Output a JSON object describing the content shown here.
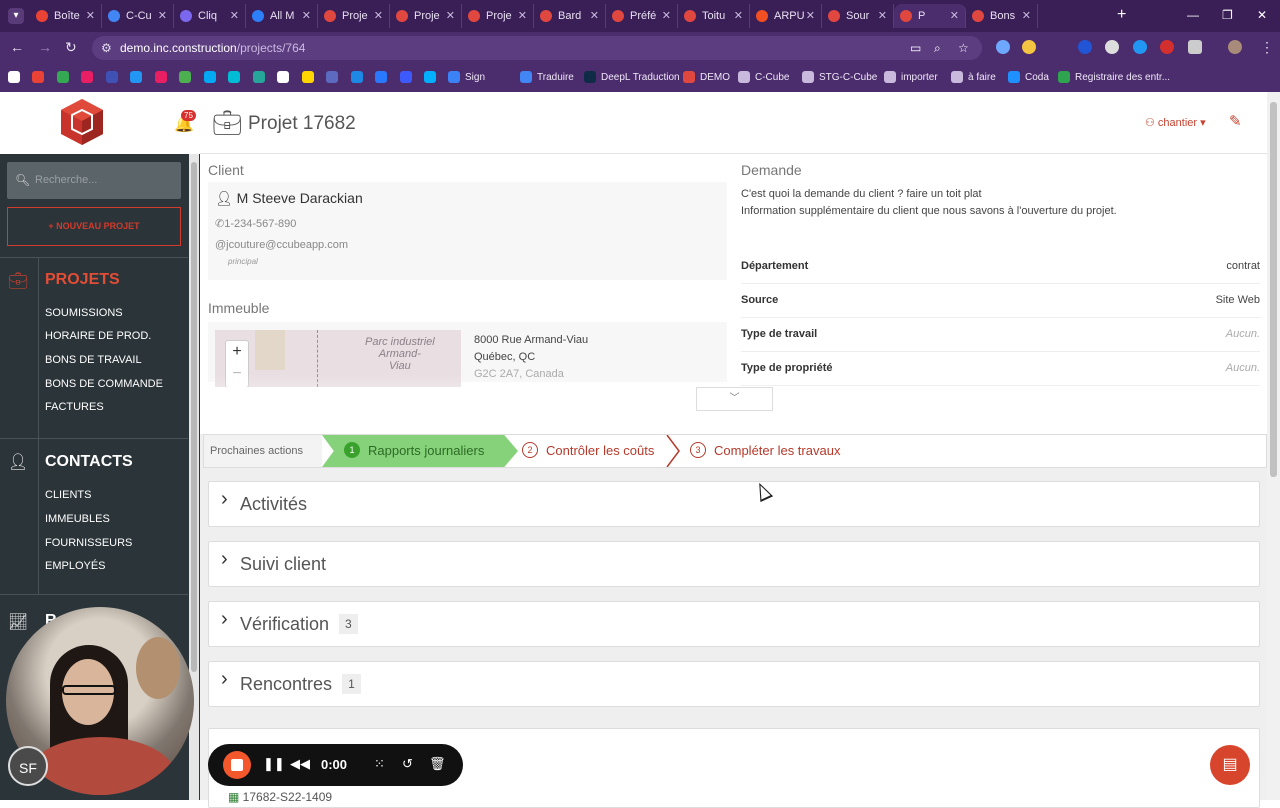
{
  "browser": {
    "tabs": [
      {
        "label": "Boîte",
        "color": "#ea4335"
      },
      {
        "label": "C-Cu",
        "color": "#4285f4"
      },
      {
        "label": "Cliq",
        "color": "#7b68ee"
      },
      {
        "label": "All M",
        "color": "#2d7ff9"
      },
      {
        "label": "Proje",
        "color": "#e0473f"
      },
      {
        "label": "Proje",
        "color": "#e0473f"
      },
      {
        "label": "Proje",
        "color": "#e0473f"
      },
      {
        "label": "Bard",
        "color": "#e0473f"
      },
      {
        "label": "Préfé",
        "color": "#e0473f"
      },
      {
        "label": "Toitu",
        "color": "#e0473f"
      },
      {
        "label": "ARPU",
        "color": "#f25022"
      },
      {
        "label": "Sour",
        "color": "#e0473f"
      },
      {
        "label": "P",
        "color": "#e0473f",
        "active": true
      },
      {
        "label": "Bons",
        "color": "#e0473f"
      }
    ],
    "url_host": "demo.inc.construction",
    "url_path": "/projects/764",
    "bookmarks": [
      {
        "label": "Sign",
        "color": "#3b82f6"
      },
      {
        "label": "Traduire",
        "color": "#4285f4"
      },
      {
        "label": "DeepL Traduction",
        "color": "#0f2b46"
      },
      {
        "label": "DEMO",
        "color": "#e0473f"
      },
      {
        "label": "C-Cube",
        "color": "#c9b9dd"
      },
      {
        "label": "STG-C-Cube",
        "color": "#c9b9dd"
      },
      {
        "label": "importer",
        "color": "#c9b9dd"
      },
      {
        "label": "à faire",
        "color": "#c9b9dd"
      },
      {
        "label": "Coda",
        "color": "#1e90ff"
      },
      {
        "label": "Registraire des entr...",
        "color": "#2ea44f"
      }
    ]
  },
  "sidebar": {
    "notification_count": "75",
    "search_placeholder": "Recherche...",
    "new_project_label": "+ NOUVEAU PROJET",
    "projects": {
      "title": "PROJETS",
      "items": [
        "SOUMISSIONS",
        "HORAIRE DE PROD.",
        "BONS DE TRAVAIL",
        "BONS DE COMMANDE",
        "FACTURES"
      ]
    },
    "contacts": {
      "title": "CONTACTS",
      "items": [
        "CLIENTS",
        "IMMEUBLES",
        "FOURNISSEURS",
        "EMPLOYÉS"
      ]
    },
    "reports_title_partial": "R"
  },
  "header": {
    "title": "Projet 17682",
    "view_select": "chantier"
  },
  "client": {
    "section_label": "Client",
    "name": "M Steeve Darackian",
    "phone": "1-234-567-890",
    "email": "jcouture@ccubeapp.com",
    "email_tag": "principal"
  },
  "building": {
    "section_label": "Immeuble",
    "map_label_1": "Parc industriel",
    "map_label_2": "Armand-",
    "map_label_3": "Viau",
    "address_line1": "8000 Rue Armand-Viau",
    "address_line2": "Québec, QC",
    "address_line3": "G2C 2A7, Canada"
  },
  "request": {
    "section_label": "Demande",
    "line1": "C'est quoi la demande du client ? faire un toit plat",
    "line2": "Information supplémentaire du client que nous savons à l'ouverture du projet."
  },
  "fields": [
    {
      "key": "Département",
      "value": "contrat",
      "empty": false
    },
    {
      "key": "Source",
      "value": "Site Web",
      "empty": false
    },
    {
      "key": "Type de travail",
      "value": "Aucun.",
      "empty": true
    },
    {
      "key": "Type de propriété",
      "value": "Aucun.",
      "empty": true
    }
  ],
  "steps": {
    "label": "Prochaines actions",
    "items": [
      {
        "num": "1",
        "label": "Rapports journaliers"
      },
      {
        "num": "2",
        "label": "Contrôler les coûts"
      },
      {
        "num": "3",
        "label": "Compléter les travaux"
      }
    ]
  },
  "panels": [
    {
      "title": "Activités",
      "count": ""
    },
    {
      "title": "Suivi client",
      "count": ""
    },
    {
      "title": "Vérification",
      "count": "3"
    },
    {
      "title": "Rencontres",
      "count": "1"
    }
  ],
  "file_row": "17682-S22-1409",
  "recorder": {
    "time": "0:00"
  },
  "user_initials": "SF"
}
